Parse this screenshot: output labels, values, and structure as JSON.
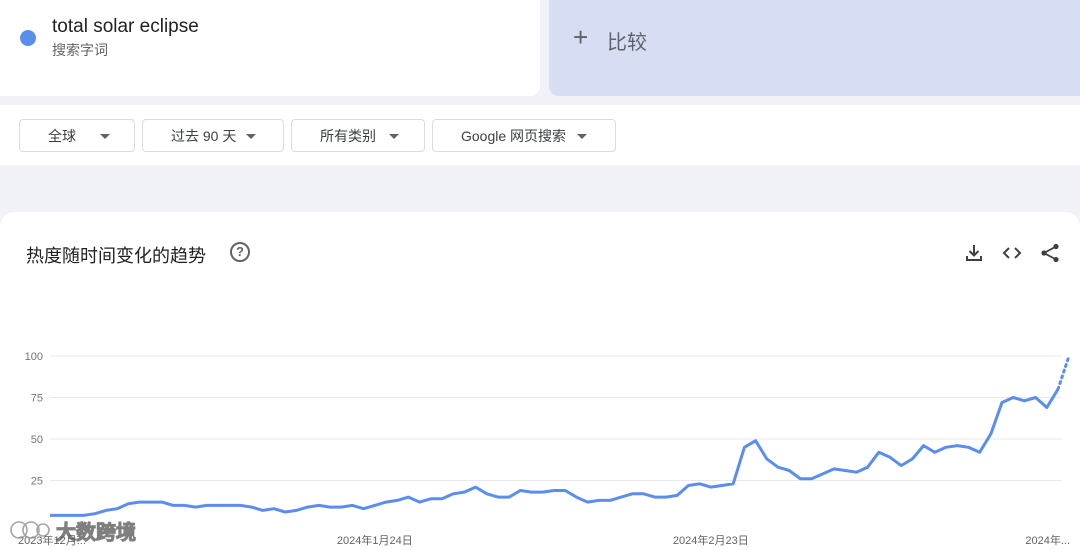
{
  "term": {
    "name": "total solar eclipse",
    "type": "搜索字词",
    "color": "#5b8def"
  },
  "compare": {
    "label": "比较",
    "icon": "plus-icon"
  },
  "filters": [
    {
      "label": "全球"
    },
    {
      "label": "过去 90 天"
    },
    {
      "label": "所有类别"
    },
    {
      "label": "Google 网页搜索"
    }
  ],
  "chart_section": {
    "title": "热度随时间变化的趋势",
    "help_icon": "?",
    "actions": [
      "download-icon",
      "embed-icon",
      "share-icon"
    ]
  },
  "watermark": "大数跨境",
  "chart_data": {
    "type": "line",
    "title": "热度随时间变化的趋势",
    "xlabel": "",
    "ylabel": "",
    "ylim": [
      0,
      100
    ],
    "y_ticks": [
      25,
      50,
      75,
      100
    ],
    "x_tick_labels": [
      "2023年12月...",
      "2024年1月24日",
      "2024年2月23日",
      "2024年..."
    ],
    "x_tick_days": [
      0,
      29,
      59,
      89
    ],
    "grid": true,
    "series": [
      {
        "values": [
          4,
          4,
          4,
          4,
          5,
          7,
          8,
          11,
          12,
          12,
          12,
          10,
          10,
          9,
          10,
          10,
          10,
          10,
          9,
          7,
          8,
          6,
          7,
          9,
          10,
          9,
          9,
          10,
          8,
          10,
          12,
          13,
          15,
          12,
          14,
          14,
          17,
          18,
          21,
          17,
          15,
          15,
          19,
          18,
          18,
          19,
          19,
          15,
          12,
          13,
          13,
          15,
          17,
          17,
          15,
          15,
          16,
          22,
          23,
          21,
          22,
          23,
          45,
          49,
          38,
          33,
          31,
          26,
          26,
          29,
          32,
          31,
          30,
          33,
          42,
          39,
          34,
          38,
          46,
          42,
          45,
          46,
          45,
          42,
          53,
          72,
          75,
          73,
          75,
          69,
          80
        ],
        "partial_values": [
          80,
          100
        ],
        "color": "#5b8def"
      }
    ]
  }
}
